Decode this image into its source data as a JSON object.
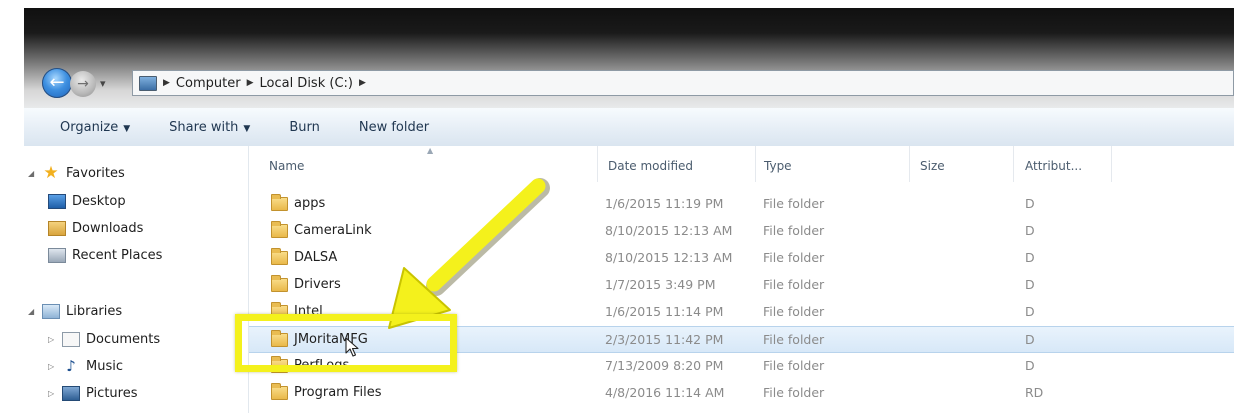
{
  "address_bar": {
    "breadcrumbs": [
      "Computer",
      "Local Disk (C:)"
    ]
  },
  "toolbar": {
    "organize": "Organize",
    "share_with": "Share with",
    "burn": "Burn",
    "new_folder": "New folder"
  },
  "nav_pane": {
    "favorites": {
      "label": "Favorites",
      "items": [
        "Desktop",
        "Downloads",
        "Recent Places"
      ]
    },
    "libraries": {
      "label": "Libraries",
      "items": [
        "Documents",
        "Music",
        "Pictures"
      ]
    }
  },
  "columns": {
    "name": "Name",
    "date": "Date modified",
    "type": "Type",
    "size": "Size",
    "attributes": "Attribut..."
  },
  "files": [
    {
      "name": "apps",
      "date": "1/6/2015 11:19 PM",
      "type": "File folder",
      "attr": "D"
    },
    {
      "name": "CameraLink",
      "date": "8/10/2015 12:13 AM",
      "type": "File folder",
      "attr": "D"
    },
    {
      "name": "DALSA",
      "date": "8/10/2015 12:13 AM",
      "type": "File folder",
      "attr": "D"
    },
    {
      "name": "Drivers",
      "date": "1/7/2015 3:49 PM",
      "type": "File folder",
      "attr": "D"
    },
    {
      "name": "Intel",
      "date": "1/6/2015 11:14 PM",
      "type": "File folder",
      "attr": "D"
    },
    {
      "name": "JMoritaMFG",
      "date": "2/3/2015 11:42 PM",
      "type": "File folder",
      "attr": "D"
    },
    {
      "name": "PerfLogs",
      "date": "7/13/2009 8:20 PM",
      "type": "File folder",
      "attr": "D"
    },
    {
      "name": "Program Files",
      "date": "4/8/2016 11:14 AM",
      "type": "File folder",
      "attr": "RD"
    }
  ],
  "selected_file": "JMoritaMFG",
  "colors": {
    "selection": "#d7e8f8",
    "highlight": "#f4f11c"
  }
}
